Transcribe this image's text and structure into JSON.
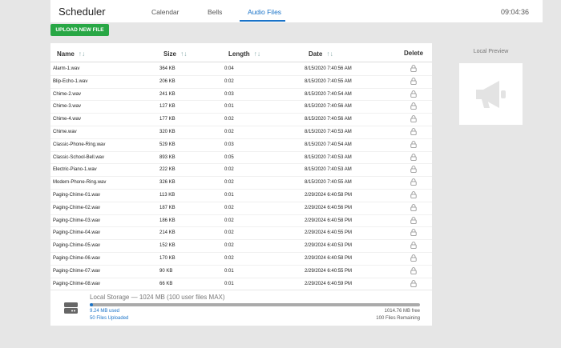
{
  "app": {
    "title": "Scheduler",
    "clock": "09:04:36"
  },
  "nav": {
    "tabs": [
      {
        "label": "Calendar"
      },
      {
        "label": "Bells"
      },
      {
        "label": "Audio Files"
      }
    ],
    "active": "Audio Files"
  },
  "toolbar": {
    "upload_label": "UPLOAD NEW FILE"
  },
  "table": {
    "headers": {
      "name": "Name",
      "size": "Size",
      "length": "Length",
      "date": "Date",
      "delete": "Delete"
    },
    "sort_glyph": "↑↓",
    "rows": [
      {
        "name": "Alarm-1.wav",
        "size": "364 KB",
        "length": "0:04",
        "date": "8/15/2020 7:40:56 AM"
      },
      {
        "name": "Blip-Echo-1.wav",
        "size": "206 KB",
        "length": "0:02",
        "date": "8/15/2020 7:40:55 AM"
      },
      {
        "name": "Chime-2.wav",
        "size": "241 KB",
        "length": "0:03",
        "date": "8/15/2020 7:40:54 AM"
      },
      {
        "name": "Chime-3.wav",
        "size": "127 KB",
        "length": "0:01",
        "date": "8/15/2020 7:40:56 AM"
      },
      {
        "name": "Chime-4.wav",
        "size": "177 KB",
        "length": "0:02",
        "date": "8/15/2020 7:40:56 AM"
      },
      {
        "name": "Chime.wav",
        "size": "320 KB",
        "length": "0:02",
        "date": "8/15/2020 7:40:53 AM"
      },
      {
        "name": "Classic-Phone-Ring.wav",
        "size": "529 KB",
        "length": "0:03",
        "date": "8/15/2020 7:40:54 AM"
      },
      {
        "name": "Classic-School-Bell.wav",
        "size": "893 KB",
        "length": "0:05",
        "date": "8/15/2020 7:40:53 AM"
      },
      {
        "name": "Electric-Piano-1.wav",
        "size": "222 KB",
        "length": "0:02",
        "date": "8/15/2020 7:40:53 AM"
      },
      {
        "name": "Modern-Phone-Ring.wav",
        "size": "326 KB",
        "length": "0:02",
        "date": "8/15/2020 7:40:55 AM"
      },
      {
        "name": "Paging-Chime-01.wav",
        "size": "113 KB",
        "length": "0:01",
        "date": "2/29/2024 6:40:58 PM"
      },
      {
        "name": "Paging-Chime-02.wav",
        "size": "187 KB",
        "length": "0:02",
        "date": "2/29/2024 6:40:56 PM"
      },
      {
        "name": "Paging-Chime-03.wav",
        "size": "186 KB",
        "length": "0:02",
        "date": "2/29/2024 6:40:58 PM"
      },
      {
        "name": "Paging-Chime-04.wav",
        "size": "214 KB",
        "length": "0:02",
        "date": "2/29/2024 6:40:55 PM"
      },
      {
        "name": "Paging-Chime-05.wav",
        "size": "152 KB",
        "length": "0:02",
        "date": "2/29/2024 6:40:53 PM"
      },
      {
        "name": "Paging-Chime-06.wav",
        "size": "170 KB",
        "length": "0:02",
        "date": "2/29/2024 6:40:58 PM"
      },
      {
        "name": "Paging-Chime-07.wav",
        "size": "90 KB",
        "length": "0:01",
        "date": "2/29/2024 6:40:55 PM"
      },
      {
        "name": "Paging-Chime-08.wav",
        "size": "66 KB",
        "length": "0:01",
        "date": "2/29/2024 6:40:59 PM"
      }
    ],
    "row_delete_icon": "lock-icon"
  },
  "preview": {
    "label": "Local Preview",
    "icon": "megaphone-icon"
  },
  "storage": {
    "title": "Local Storage — 1024 MB (100 user files MAX)",
    "used": "9.24 MB used",
    "free": "1014.76 MB free",
    "files_uploaded": "50 Files Uploaded",
    "files_remaining": "100 Files Remaining",
    "used_fraction": 0.009
  },
  "colors": {
    "accent": "#1a73c8",
    "upload_button": "#28a745",
    "background": "#e6e6e6"
  }
}
